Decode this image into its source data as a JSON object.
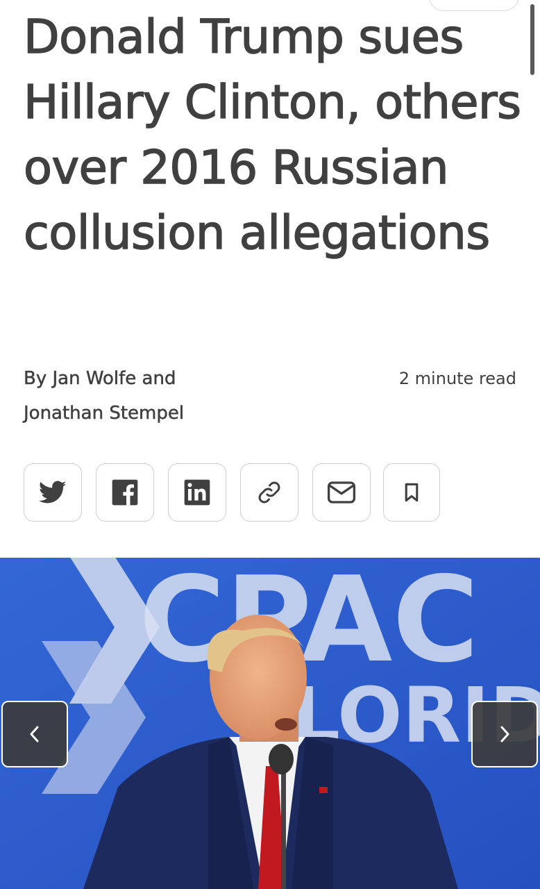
{
  "article": {
    "headline": "Donald Trump sues Hillary Clinton, others over 2016 Russian collusion allegations",
    "byline": {
      "line1": "By Jan Wolfe and",
      "line2": "Jonathan Stempel"
    },
    "read_time": "2 minute read"
  },
  "share_bar": {
    "buttons": [
      {
        "icon": "twitter-icon"
      },
      {
        "icon": "facebook-icon"
      },
      {
        "icon": "linkedin-icon"
      },
      {
        "icon": "link-icon"
      },
      {
        "icon": "mail-icon"
      },
      {
        "icon": "bookmark-icon"
      }
    ]
  },
  "photo": {
    "background_text": "CPAC",
    "background_subtext": "LORIDA",
    "prev_icon": "chevron-left-icon",
    "next_icon": "chevron-right-icon"
  },
  "colors": {
    "text": "#404040",
    "border": "#cfcfcf",
    "photo_blue": "#2a5cc8"
  }
}
